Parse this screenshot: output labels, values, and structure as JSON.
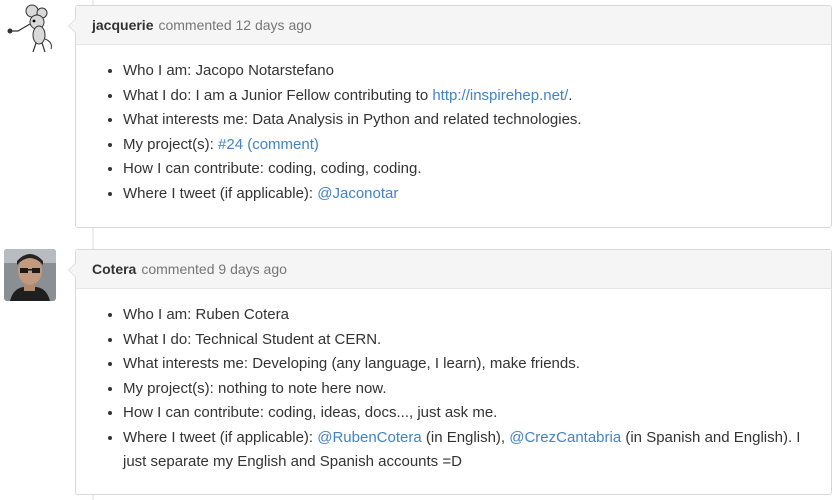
{
  "colors": {
    "link": "#4183c4",
    "header_bg": "#f5f5f5",
    "border": "#d8d8d8",
    "text": "#333333",
    "muted": "#767676"
  },
  "comments": [
    {
      "avatar": "mouse-avatar",
      "author": "jacquerie",
      "action": "commented 12 days ago",
      "items": [
        {
          "label": "Who I am:",
          "text": "Jacopo Notarstefano"
        },
        {
          "label": "What I do:",
          "text": "I am a Junior Fellow contributing to",
          "link": "http://inspirehep.net/",
          "after": "."
        },
        {
          "label": "What interests me:",
          "text": "Data Analysis in Python and related technologies."
        },
        {
          "label": "My project(s):",
          "link": "#24 (comment)"
        },
        {
          "label": "How I can contribute:",
          "text": "coding, coding, coding."
        },
        {
          "label": "Where I tweet (if applicable):",
          "link": "@Jaconotar"
        }
      ]
    },
    {
      "avatar": "person-avatar",
      "author": "Cotera",
      "action": "commented 9 days ago",
      "items": [
        {
          "label": "Who I am:",
          "text": "Ruben Cotera"
        },
        {
          "label": "What I do:",
          "text": "Technical Student at CERN."
        },
        {
          "label": "What interests me:",
          "text": "Developing (any language, I learn), make friends."
        },
        {
          "label": "My project(s):",
          "text": "nothing to note here now."
        },
        {
          "label": "How I can contribute:",
          "text": "coding, ideas, docs..., just ask me."
        },
        {
          "label": "Where I tweet (if applicable):",
          "link": "@RubenCotera",
          "middle": "(in English),",
          "link2": "@CrezCantabria",
          "after": "(in Spanish and English). I just separate my English and Spanish accounts =D"
        }
      ]
    }
  ]
}
